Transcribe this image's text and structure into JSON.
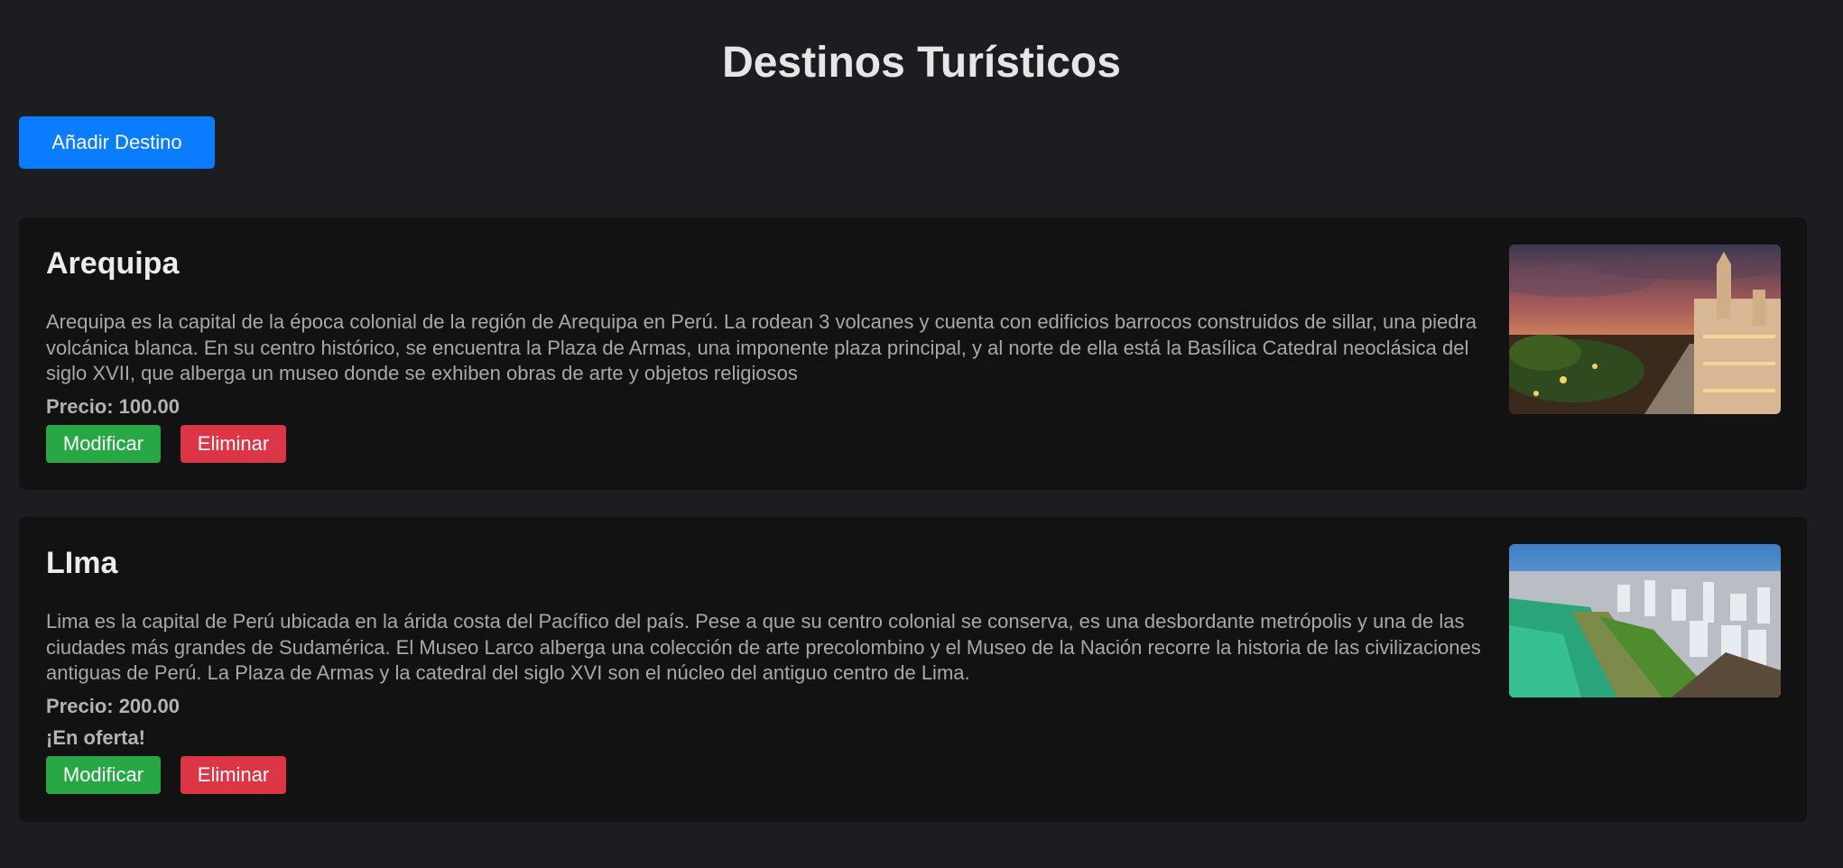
{
  "header": {
    "title": "Destinos Turísticos"
  },
  "toolbar": {
    "add_label": "Añadir Destino"
  },
  "destinations": [
    {
      "name": "Arequipa",
      "description": "Arequipa es la capital de la época colonial de la región de Arequipa en Perú. La rodean 3 volcanes y cuenta con edificios barrocos construidos de sillar, una piedra volcánica blanca. En su centro histórico, se encuentra la Plaza de Armas, una imponente plaza principal, y al norte de ella está la Basílica Catedral neoclásica del siglo XVII, que alberga un museo donde se exhiben obras de arte y objetos religiosos",
      "price": "Precio: 100.00",
      "offer": "",
      "edit_label": "Modificar",
      "delete_label": "Eliminar",
      "image": "arequipa-cathedral-sunset-photo"
    },
    {
      "name": "LIma",
      "description": "Lima es la capital de Perú ubicada en la árida costa del Pacífico del país. Pese a que su centro colonial se conserva, es una desbordante metrópolis y una de las ciudades más grandes de Sudamérica. El Museo Larco alberga una colección de arte precolombino y el Museo de la Nación recorre la historia de las civilizaciones antiguas de Perú. La Plaza de Armas y la catedral del siglo XVI son el núcleo del antiguo centro de Lima.",
      "price": "Precio: 200.00",
      "offer": "¡En oferta!",
      "edit_label": "Modificar",
      "delete_label": "Eliminar",
      "image": "lima-coastline-aerial-photo"
    }
  ],
  "colors": {
    "background": "#1c1d20",
    "card": "#121212",
    "primary": "#0a7cff",
    "success": "#28a745",
    "danger": "#dc3545"
  }
}
